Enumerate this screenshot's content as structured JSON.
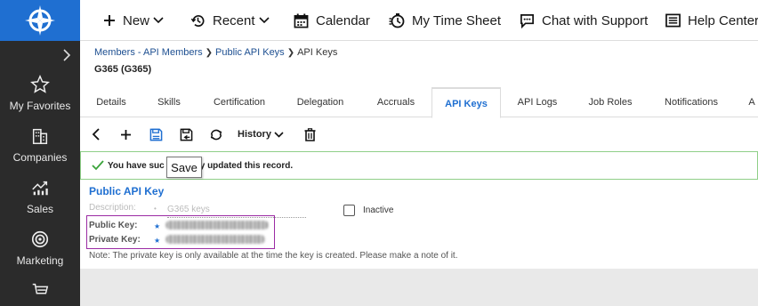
{
  "sidebar": {
    "items": [
      {
        "label": "My Favorites",
        "icon": "star-icon"
      },
      {
        "label": "Companies",
        "icon": "building-icon"
      },
      {
        "label": "Sales",
        "icon": "chart-icon"
      },
      {
        "label": "Marketing",
        "icon": "target-icon"
      },
      {
        "label": "",
        "icon": "cart-icon"
      }
    ]
  },
  "topbar": {
    "new_label": "New",
    "recent_label": "Recent",
    "calendar_label": "Calendar",
    "timesheet_label": "My Time Sheet",
    "chat_label": "Chat with Support",
    "help_label": "Help Center"
  },
  "breadcrumb": {
    "items": [
      "Members - API Members",
      "Public API Keys",
      "API Keys"
    ]
  },
  "record_title": "G365 (G365)",
  "tabs": [
    {
      "label": "Details"
    },
    {
      "label": "Skills"
    },
    {
      "label": "Certification"
    },
    {
      "label": "Delegation"
    },
    {
      "label": "Accruals"
    },
    {
      "label": "API Keys",
      "active": true
    },
    {
      "label": "API Logs"
    },
    {
      "label": "Job Roles"
    },
    {
      "label": "Notifications"
    },
    {
      "label": "A"
    }
  ],
  "toolbar": {
    "history_label": "History"
  },
  "alert": {
    "text_before": "You have suc",
    "text_after": "y updated this record."
  },
  "tooltip": "Save",
  "form": {
    "section_title": "Public API Key",
    "description_label": "Description:",
    "description_value": "G365 keys",
    "public_key_label": "Public Key:",
    "private_key_label": "Private Key:",
    "inactive_label": "Inactive",
    "note": "Note: The private key is only available at the time the key is created. Please make a note of it."
  },
  "colors": {
    "accent": "#1f6fd1",
    "sidebar_bg": "#2b2b2b",
    "success_border": "#8fcf88",
    "highlight_border": "#9b2ba4"
  }
}
